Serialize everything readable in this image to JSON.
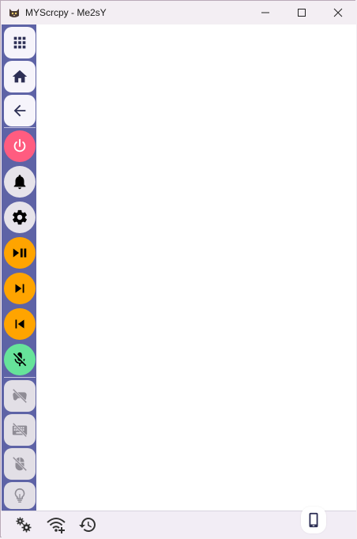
{
  "window": {
    "title": "MYScrcpy - Me2sY",
    "app_icon": "cat-icon",
    "controls": [
      "minimize-icon",
      "maximize-icon",
      "close-icon"
    ]
  },
  "sidebar": {
    "buttons": [
      {
        "name": "apps-button",
        "icon": "grid-icon",
        "style": "square"
      },
      {
        "name": "home-button",
        "icon": "home-icon",
        "style": "square"
      },
      {
        "name": "back-button",
        "icon": "arrow-left-icon",
        "style": "square"
      },
      {
        "name": "power-button",
        "icon": "power-icon",
        "style": "circle",
        "color": "#ff5c80"
      },
      {
        "name": "notifications-button",
        "icon": "bell-icon",
        "style": "circle",
        "color": "#e6e3ea"
      },
      {
        "name": "settings-button",
        "icon": "gear-icon",
        "style": "circle",
        "color": "#e6e3ea"
      },
      {
        "name": "play-pause-button",
        "icon": "play-pause-icon",
        "style": "circle",
        "color": "#ffa400"
      },
      {
        "name": "next-track-button",
        "icon": "skip-next-icon",
        "style": "circle",
        "color": "#ffa400"
      },
      {
        "name": "previous-track-button",
        "icon": "skip-previous-icon",
        "style": "circle",
        "color": "#ffa400"
      },
      {
        "name": "mic-toggle-button",
        "icon": "mic-off-icon",
        "style": "circle",
        "color": "#66e39a"
      },
      {
        "name": "gamepad-toggle-button",
        "icon": "gamepad-off-icon",
        "style": "square-disabled"
      },
      {
        "name": "keyboard-toggle-button",
        "icon": "keyboard-off-icon",
        "style": "square-disabled"
      },
      {
        "name": "mouse-toggle-button",
        "icon": "mouse-off-icon",
        "style": "square-disabled"
      },
      {
        "name": "light-toggle-button",
        "icon": "lightbulb-icon",
        "style": "square-disabled"
      }
    ]
  },
  "bottombar": {
    "buttons": [
      "settings-cog-icon",
      "wifi-add-icon",
      "history-icon"
    ],
    "device_button": "smartphone-icon"
  },
  "colors": {
    "sidebar_bg": "#5e63a6",
    "accent_red": "#ff5c80",
    "accent_orange": "#ffa400",
    "accent_green": "#66e39a"
  }
}
